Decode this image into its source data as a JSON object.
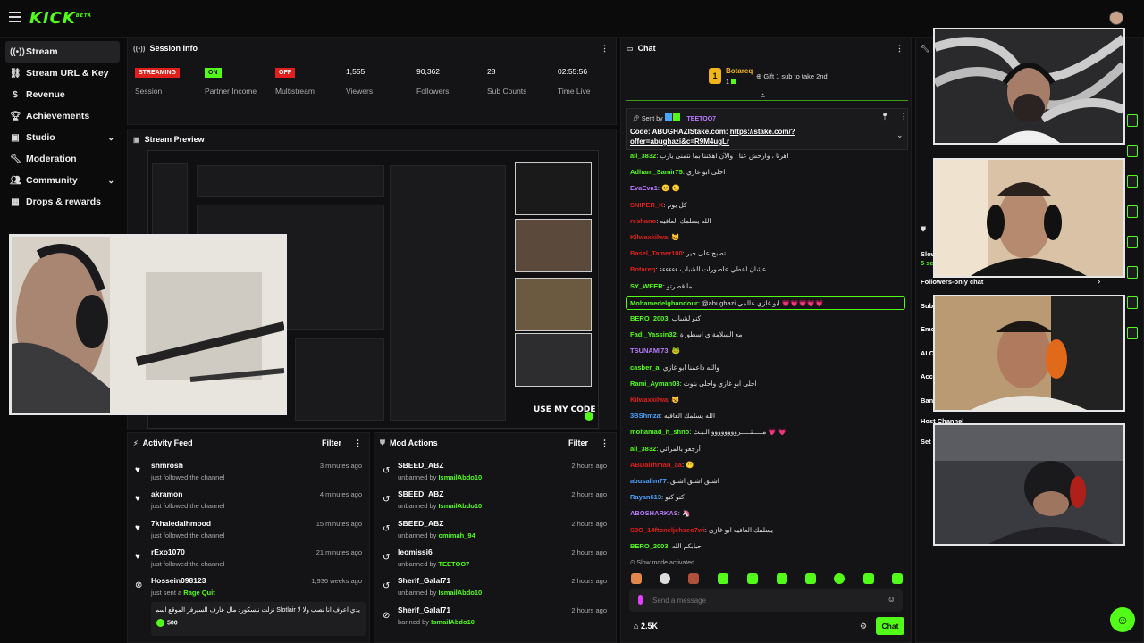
{
  "app": {
    "logo": "KICK",
    "logo_sup": "BETA"
  },
  "sidebar": {
    "items": [
      {
        "label": "Stream",
        "icon": "stream-icon"
      },
      {
        "label": "Stream URL & Key",
        "icon": "link-icon"
      },
      {
        "label": "Revenue",
        "icon": "dollar-icon"
      },
      {
        "label": "Achievements",
        "icon": "trophy-icon"
      },
      {
        "label": "Studio",
        "icon": "studio-icon"
      },
      {
        "label": "Moderation",
        "icon": "wrench-icon"
      },
      {
        "label": "Community",
        "icon": "people-icon"
      },
      {
        "label": "Drops & rewards",
        "icon": "gift-icon"
      }
    ]
  },
  "session": {
    "title": "Session Info",
    "streaming": "STREAMING",
    "session_label": "Session",
    "partner": "ON",
    "partner_label": "Partner Income",
    "multistream": "OFF",
    "multistream_label": "Multistream",
    "viewers": "1,555",
    "viewers_label": "Viewers",
    "followers": "90,362",
    "followers_label": "Followers",
    "subs": "28",
    "subs_label": "Sub Counts",
    "time": "02:55:56",
    "time_label": "Time Live"
  },
  "preview": {
    "title": "Stream Preview",
    "overlay_text": "USE MY CODE"
  },
  "activity": {
    "title": "Activity Feed",
    "filter": "Filter",
    "items": [
      {
        "name": "shmrosh",
        "sub": "just followed the channel",
        "time": "3 minutes ago"
      },
      {
        "name": "akramon",
        "sub": "just followed the channel",
        "time": "4 minutes ago"
      },
      {
        "name": "7khaledalhmood",
        "sub": "just followed the channel",
        "time": "15 minutes ago"
      },
      {
        "name": "rExo1070",
        "sub": "just followed the channel",
        "time": "21 minutes ago"
      },
      {
        "name": "Hossein098123",
        "sub_prefix": "just sent a",
        "sub_item": "Rage Quit",
        "time": "1,936 weeks ago"
      }
    ],
    "message": "يدي اعرف انا نصب ولا لا Slotlair نزلت نيسكورد مال عارف السيرفر الموقع اسم",
    "amount": "500"
  },
  "mod": {
    "title": "Mod Actions",
    "filter": "Filter",
    "items": [
      {
        "name": "SBEED_ABZ",
        "action": "unbanned by",
        "by": "IsmailAbdo10",
        "time": "2 hours ago"
      },
      {
        "name": "SBEED_ABZ",
        "action": "unbanned by",
        "by": "IsmailAbdo10",
        "time": "2 hours ago"
      },
      {
        "name": "SBEED_ABZ",
        "action": "unbanned by",
        "by": "omimah_94",
        "time": "2 hours ago"
      },
      {
        "name": "leomissi6",
        "action": "unbanned by",
        "by": "TEETOO7",
        "time": "2 hours ago"
      },
      {
        "name": "Sherif_Galal71",
        "action": "unbanned by",
        "by": "IsmailAbdo10",
        "time": "2 hours ago"
      },
      {
        "name": "Sherif_Galal71",
        "action": "banned by",
        "by": "IsmailAbdo10",
        "time": "2 hours ago"
      }
    ]
  },
  "chat": {
    "title": "Chat",
    "gifter": "Botareq",
    "gifter_count": "1",
    "gift_text": "Gift 1 sub to take 2nd",
    "sent_by_label": "Sent by",
    "sent_by_user": "TEETOO7",
    "pinned_text": "Code: ABUGHAZIStake.com:",
    "pinned_link": "https://stake.com/?offer=abughazi&c=R9M4ugLr",
    "messages": [
      {
        "user": "ali_3832",
        "color": "#53fc18",
        "text": "اهرنا ، وارحش عنا ، والآن اهكننا بما نتمنى يارب"
      },
      {
        "user": "Adham_Samir75",
        "color": "#53fc18",
        "text": "احلى ابو غازي"
      },
      {
        "user": "EvaEva1",
        "color": "#b97bff",
        "text": "🙂 🙂"
      },
      {
        "user": "SNIPER_K",
        "color": "#e0201d",
        "text": "كل يوم"
      },
      {
        "user": "reshano",
        "color": "#e0201d",
        "text": "الله يسلمك العافيه"
      },
      {
        "user": "Kilwaxkilwa",
        "color": "#e0201d",
        "text": "😺"
      },
      {
        "user": "Basel_Tamer100",
        "color": "#e0201d",
        "text": "تصبح على خير"
      },
      {
        "user": "Botareq",
        "color": "#e0201d",
        "text": "عشان اعطي عاصورات الشباب ءءءءءء"
      },
      {
        "user": "SY_WEER",
        "color": "#53fc18",
        "text": "ما قصرتو"
      },
      {
        "user": "Mohamedelghandour",
        "color": "#53fc18",
        "text": "@abughazi ابو غازي عالمي 💗💗💗💗💗"
      },
      {
        "user": "BERO_2003",
        "color": "#53fc18",
        "text": "كنو لشباب"
      },
      {
        "user": "Fadi_Yassin32",
        "color": "#53fc18",
        "text": "مع السلامة ي اسطورة"
      },
      {
        "user": "TSUNAMI73",
        "color": "#b97bff",
        "text": "🐸"
      },
      {
        "user": "casber_a",
        "color": "#53fc18",
        "text": "والله داعمنا ابو غازي"
      },
      {
        "user": "Rami_Ayman03",
        "color": "#53fc18",
        "text": "احلى ابو غازي واحلى بثوث"
      },
      {
        "user": "Kilwaxkilwa",
        "color": "#e0201d",
        "text": "😺"
      },
      {
        "user": "3BShmza",
        "color": "#4aa3ff",
        "text": "الله يسلمك العافيه"
      },
      {
        "user": "mohamad_h_shno",
        "color": "#53fc18",
        "text": "💗 💗 مـــــتـــــروووووووو الـبـث"
      },
      {
        "user": "ali_3832",
        "color": "#53fc18",
        "text": "أرجعو بالمراثي"
      },
      {
        "user": "ABDalrhman_aa",
        "color": "#e0201d",
        "text": "😶"
      },
      {
        "user": "abusalim77",
        "color": "#4aa3ff",
        "text": "اشتق اشتق اشتق"
      },
      {
        "user": "Rayan613",
        "color": "#4aa3ff",
        "text": "كنو كنو"
      },
      {
        "user": "ABOSHARKAS",
        "color": "#b97bff",
        "text": "🦄"
      },
      {
        "user": "S3O_14ftoneljehseo7wi",
        "color": "#e0201d",
        "text": "يسلمك العافيه ابو غازي"
      },
      {
        "user": "BERO_2003",
        "color": "#53fc18",
        "text": "حبابكم الله"
      }
    ],
    "slow_mode": "Slow mode activated",
    "placeholder": "Send a message",
    "viewer_count": "2.5K",
    "send_label": "Chat"
  },
  "right_panel": {
    "followers_only": "Followers-only chat",
    "items": [
      "Slow",
      "Sub",
      "Emo",
      "AI C",
      "Acc",
      "Ban",
      "Host Channel",
      "Set"
    ],
    "slow_sub": "5 se"
  },
  "colors": {
    "accent": "#53fc18",
    "bg": "#0b0b0c",
    "panel": "#141416",
    "red": "#e0201d"
  }
}
